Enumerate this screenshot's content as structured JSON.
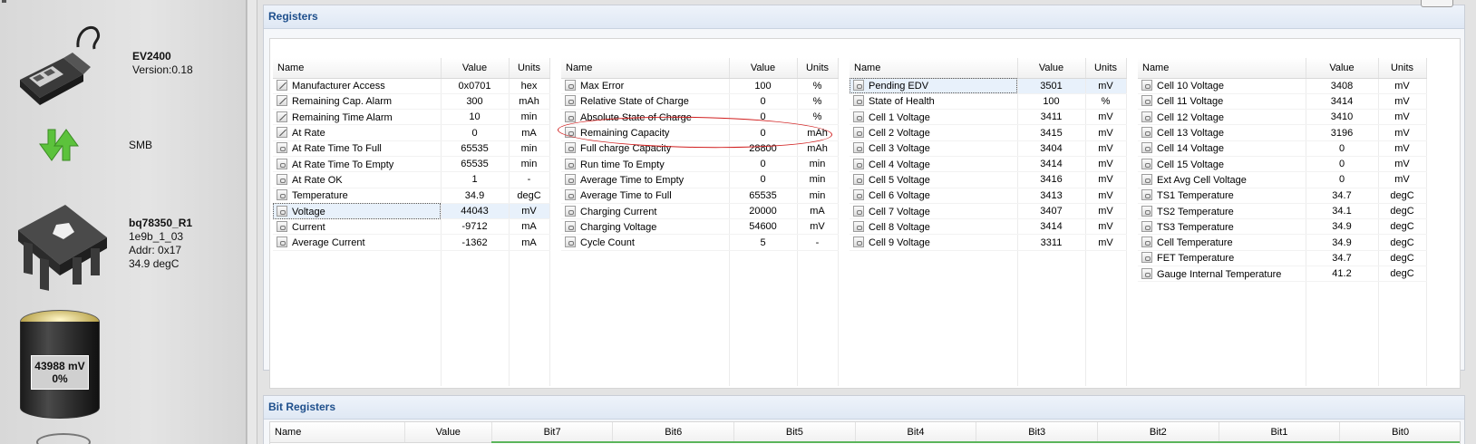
{
  "device": {
    "adapter_name": "EV2400",
    "adapter_version": "Version:0.18",
    "bus": "SMB",
    "gauge_name": "bq78350_R1",
    "gauge_fw": "1e9b_1_03",
    "gauge_addr": "Addr: 0x17",
    "gauge_temp": "34.9 degC",
    "battery_voltage": "43988 mV",
    "battery_soc": "0%",
    "soc_fraction": 0.0
  },
  "registers": {
    "title": "Registers",
    "headers": {
      "name": "Name",
      "value": "Value",
      "units": "Units"
    },
    "tables": [
      {
        "rows": [
          {
            "icon": "edit",
            "name": "Manufacturer Access",
            "value": "0x0701",
            "units": "hex"
          },
          {
            "icon": "edit",
            "name": "Remaining Cap. Alarm",
            "value": "300",
            "units": "mAh"
          },
          {
            "icon": "edit",
            "name": "Remaining Time Alarm",
            "value": "10",
            "units": "min"
          },
          {
            "icon": "edit",
            "name": "At Rate",
            "value": "0",
            "units": "mA"
          },
          {
            "icon": "lock",
            "name": "At Rate Time To Full",
            "value": "65535",
            "units": "min"
          },
          {
            "icon": "lock",
            "name": "At Rate Time To Empty",
            "value": "65535",
            "units": "min"
          },
          {
            "icon": "lock",
            "name": "At Rate OK",
            "value": "1",
            "units": "-"
          },
          {
            "icon": "lock",
            "name": "Temperature",
            "value": "34.9",
            "units": "degC"
          },
          {
            "icon": "lock",
            "name": "Voltage",
            "value": "44043",
            "units": "mV",
            "selected": true
          },
          {
            "icon": "lock",
            "name": "Current",
            "value": "-9712",
            "units": "mA"
          },
          {
            "icon": "lock",
            "name": "Average Current",
            "value": "-1362",
            "units": "mA"
          }
        ]
      },
      {
        "rows": [
          {
            "icon": "lock",
            "name": "Max Error",
            "value": "100",
            "units": "%"
          },
          {
            "icon": "lock",
            "name": "Relative State of Charge",
            "value": "0",
            "units": "%"
          },
          {
            "icon": "lock",
            "name": "Absolute State of Charge",
            "value": "0",
            "units": "%"
          },
          {
            "icon": "lock",
            "name": "Remaining Capacity",
            "value": "0",
            "units": "mAh"
          },
          {
            "icon": "lock",
            "name": "Full charge Capacity",
            "value": "28800",
            "units": "mAh"
          },
          {
            "icon": "lock",
            "name": "Run time To Empty",
            "value": "0",
            "units": "min"
          },
          {
            "icon": "lock",
            "name": "Average Time to Empty",
            "value": "0",
            "units": "min"
          },
          {
            "icon": "lock",
            "name": "Average Time to Full",
            "value": "65535",
            "units": "min"
          },
          {
            "icon": "lock",
            "name": "Charging Current",
            "value": "20000",
            "units": "mA"
          },
          {
            "icon": "lock",
            "name": "Charging Voltage",
            "value": "54600",
            "units": "mV"
          },
          {
            "icon": "lock",
            "name": "Cycle Count",
            "value": "5",
            "units": "-"
          }
        ]
      },
      {
        "rows": [
          {
            "icon": "lock",
            "name": "Pending EDV",
            "value": "3501",
            "units": "mV",
            "selected": true
          },
          {
            "icon": "lock",
            "name": "State of Health",
            "value": "100",
            "units": "%"
          },
          {
            "icon": "lock",
            "name": "Cell 1 Voltage",
            "value": "3411",
            "units": "mV"
          },
          {
            "icon": "lock",
            "name": "Cell 2 Voltage",
            "value": "3415",
            "units": "mV"
          },
          {
            "icon": "lock",
            "name": "Cell 3 Voltage",
            "value": "3404",
            "units": "mV"
          },
          {
            "icon": "lock",
            "name": "Cell 4 Voltage",
            "value": "3414",
            "units": "mV"
          },
          {
            "icon": "lock",
            "name": "Cell 5 Voltage",
            "value": "3416",
            "units": "mV"
          },
          {
            "icon": "lock",
            "name": "Cell 6 Voltage",
            "value": "3413",
            "units": "mV"
          },
          {
            "icon": "lock",
            "name": "Cell 7 Voltage",
            "value": "3407",
            "units": "mV"
          },
          {
            "icon": "lock",
            "name": "Cell 8 Voltage",
            "value": "3414",
            "units": "mV"
          },
          {
            "icon": "lock",
            "name": "Cell 9 Voltage",
            "value": "3311",
            "units": "mV"
          }
        ]
      },
      {
        "rows": [
          {
            "icon": "lock",
            "name": "Cell 10 Voltage",
            "value": "3408",
            "units": "mV"
          },
          {
            "icon": "lock",
            "name": "Cell 11 Voltage",
            "value": "3414",
            "units": "mV"
          },
          {
            "icon": "lock",
            "name": "Cell 12 Voltage",
            "value": "3410",
            "units": "mV"
          },
          {
            "icon": "lock",
            "name": "Cell 13 Voltage",
            "value": "3196",
            "units": "mV"
          },
          {
            "icon": "lock",
            "name": "Cell 14 Voltage",
            "value": "0",
            "units": "mV"
          },
          {
            "icon": "lock",
            "name": "Cell 15 Voltage",
            "value": "0",
            "units": "mV"
          },
          {
            "icon": "lock",
            "name": "Ext Avg Cell Voltage",
            "value": "0",
            "units": "mV"
          },
          {
            "icon": "lock",
            "name": "TS1 Temperature",
            "value": "34.7",
            "units": "degC"
          },
          {
            "icon": "lock",
            "name": "TS2 Temperature",
            "value": "34.1",
            "units": "degC"
          },
          {
            "icon": "lock",
            "name": "TS3 Temperature",
            "value": "34.9",
            "units": "degC"
          },
          {
            "icon": "lock",
            "name": "Cell Temperature",
            "value": "34.9",
            "units": "degC"
          },
          {
            "icon": "lock",
            "name": "FET Temperature",
            "value": "34.7",
            "units": "degC"
          },
          {
            "icon": "lock",
            "name": "Gauge Internal Temperature",
            "value": "41.2",
            "units": "degC"
          }
        ]
      }
    ]
  },
  "bit_registers": {
    "title": "Bit Registers",
    "headers": [
      "Name",
      "Value",
      "Bit7",
      "Bit6",
      "Bit5",
      "Bit4",
      "Bit3",
      "Bit2",
      "Bit1",
      "Bit0"
    ]
  },
  "colors": {
    "section_title": "#1e4f8c",
    "annotation": "#d11f1f",
    "bit_header_accent": "#5bb55b"
  }
}
